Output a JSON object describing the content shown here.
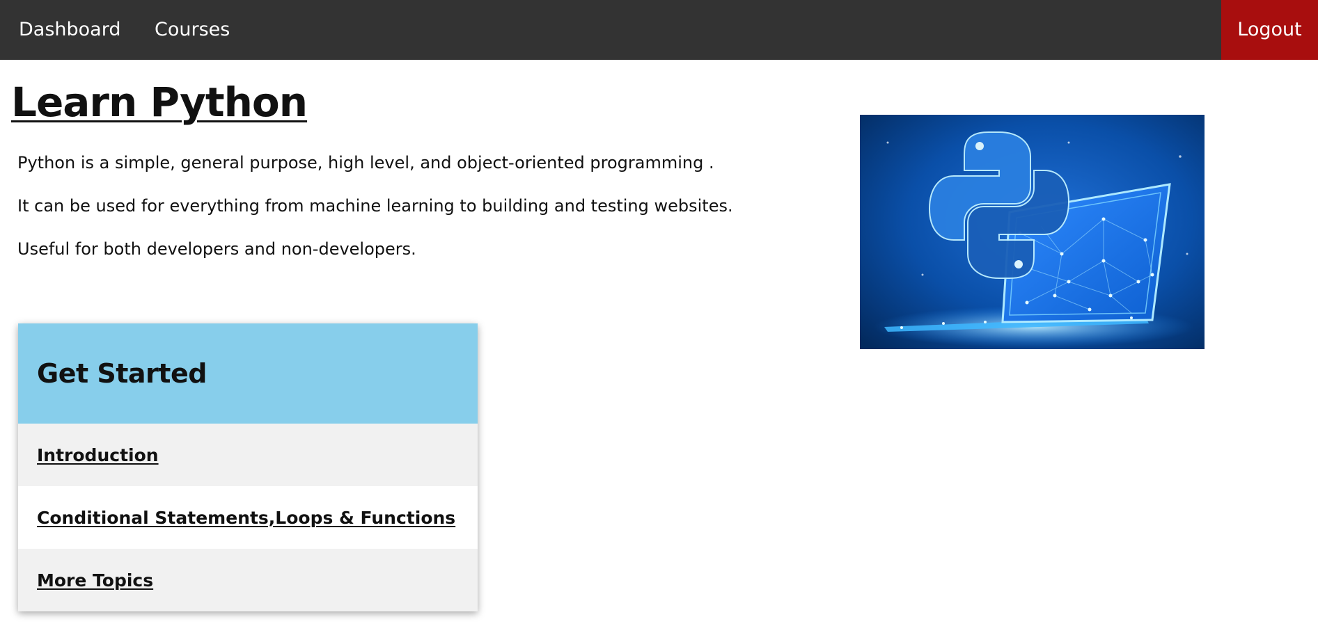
{
  "nav": {
    "dashboard": "Dashboard",
    "courses": "Courses",
    "logout": "Logout"
  },
  "page": {
    "title": "Learn Python",
    "paragraphs": [
      "Python is a simple, general purpose, high level, and object-oriented programming .",
      "It can be used for everything from machine learning to building and testing websites.",
      "Useful for both developers and non-developers."
    ]
  },
  "card": {
    "title": "Get Started",
    "items": [
      "Introduction",
      "Conditional Statements,Loops & Functions",
      "More Topics"
    ]
  },
  "colors": {
    "navbar": "#333333",
    "logout": "#a80e0e",
    "card_header": "#87ceeb",
    "card_item_shade": "#f1f1f1"
  },
  "hero_image": {
    "icon": "python-laptop-illustration"
  }
}
